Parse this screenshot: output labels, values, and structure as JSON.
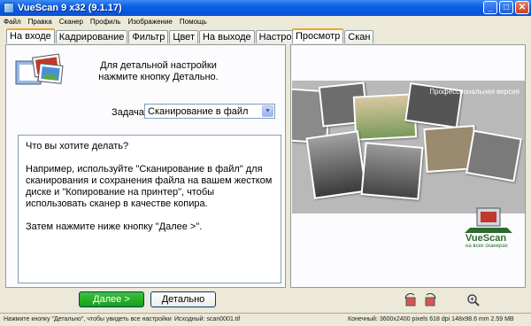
{
  "window": {
    "title": "VueScan 9 x32 (9.1.17)"
  },
  "menu": [
    "Файл",
    "Правка",
    "Сканер",
    "Профиль",
    "Изображение",
    "Помощь"
  ],
  "left_tabs": [
    "На входе",
    "Кадрирование",
    "Фильтр",
    "Цвет",
    "На выходе",
    "Настройки"
  ],
  "right_tabs": [
    "Просмотр",
    "Скан"
  ],
  "hint": {
    "line1": "Для детальной настройки",
    "line2": "нажмите кнопку Детально."
  },
  "task": {
    "label": "Задача:",
    "value": "Сканирование в файл"
  },
  "help": {
    "p1": "Что вы хотите делать?",
    "p2": "Например, используйте \"Сканирование в файл\" для сканирования и сохранения файла на вашем жестком диске и \"Копирование на принтер\", чтобы использовать сканер в качестве копира.",
    "p3": "Затем нажмите ниже кнопку \"Далее >\"."
  },
  "preview": {
    "pro_label": "Профессиональная версия",
    "brand": "VueScan",
    "brand_sub": "на всех сканерах"
  },
  "buttons": {
    "next": "Далее >",
    "detail": "Детально"
  },
  "status": {
    "left": "Нажмите кнопку \"Детально\", чтобы увидеть все настройки",
    "source": "Исходный: scan0001.tif",
    "final": "Конечный: 3600x2400 pixels 618 dpi 148x98.6 mm 2.59 MB"
  },
  "colors": {
    "titlebar": "#0b5fe6",
    "next_button": "#14a014",
    "tab_highlight": "#f5a623"
  }
}
